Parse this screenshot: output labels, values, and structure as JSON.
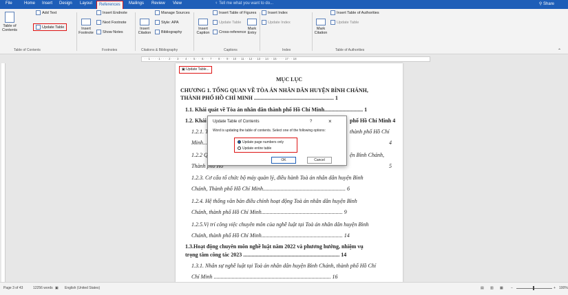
{
  "tabs": [
    "File",
    "Home",
    "Insert",
    "Design",
    "Layout",
    "References",
    "Mailings",
    "Review",
    "View"
  ],
  "tell_me": "Tell me what you want to do...",
  "share": "Share",
  "ribbon": {
    "toc": {
      "table_of_contents": "Table of Contents",
      "add_text": "Add Text",
      "update_table": "Update Table",
      "label": "Table of Contents"
    },
    "footnotes": {
      "insert_footnote": "Insert Footnote",
      "insert_endnote": "Insert Endnote",
      "next_footnote": "Next Footnote",
      "show_notes": "Show Notes",
      "label": "Footnotes"
    },
    "citations": {
      "insert_citation": "Insert Citation",
      "manage_sources": "Manage Sources",
      "style": "Style: APA",
      "bibliography": "Bibliography",
      "label": "Citations & Bibliography"
    },
    "captions": {
      "insert_caption": "Insert Caption",
      "insert_table_of_figures": "Insert Table of Figures",
      "update_table": "Update Table",
      "cross_reference": "Cross-reference",
      "label": "Captions"
    },
    "index": {
      "mark_entry": "Mark Entry",
      "insert_index": "Insert Index",
      "update_index": "Update Index",
      "label": "Index"
    },
    "authorities": {
      "mark_citation": "Mark Citation",
      "insert_table_of_authorities": "Insert Table of Authorities",
      "update_table": "Update Table",
      "label": "Table of Authorities"
    }
  },
  "document": {
    "toc_update_button": "Update Table...",
    "title": "MỤC LỤC",
    "lines": [
      {
        "text": "CHƯƠNG 1. TỔNG QUAN VỀ TÒA ÁN NHÂN DÂN HUYỆN BÌNH CHÁNH,",
        "style": "b"
      },
      {
        "text": "THÀNH PHỐ HỒ CHÍ MINH .......................................................... 1",
        "style": "b"
      },
      {
        "text": "1.1. Khái quát về Tòa án nhân dân thành phố Hồ Chí Minh............................ 1",
        "style": "b"
      },
      {
        "text": "1.2. Khái quát v",
        "style": "b"
      },
      {
        "text": "1.2.1. Thông ti",
        "style": "i"
      },
      {
        "text": "Minh..............",
        "style": "i"
      },
      {
        "text": "1.2.2 Quá trình",
        "style": "i"
      },
      {
        "text": "Thành phố Hồ",
        "style": "i"
      },
      {
        "text": "1.2.3. Cơ cấu tổ chức bộ máy quản lý, điều hành Toà án nhân dân huyện Bình",
        "style": "i"
      },
      {
        "text": "Chánh, Thành phố Hồ Chí Minh............................................................ 6",
        "style": "i"
      },
      {
        "text": "1.2.4. Hệ thống văn bản điều chỉnh hoạt động Toà án nhân dân huyện Bình",
        "style": "i"
      },
      {
        "text": "Chánh, thành phố Hồ Chí Minh........................................................... 9",
        "style": "i"
      },
      {
        "text": "1.2.5.Vị trí công việc chuyên môn của nghề luật tại Toà án nhân dân huyện Bình",
        "style": "i"
      },
      {
        "text": "Chánh, thành phố Hồ Chí Minh........................................................... 14",
        "style": "i"
      },
      {
        "text": "1.3.Hoạt động chuyên môn nghề luật năm 2022 và phương hướng, nhiệm vụ",
        "style": "b"
      },
      {
        "text": "trọng tâm công tác 2023 ...................................................................... 14",
        "style": "b"
      },
      {
        "text": "1.3.1. Nhân sự nghề luật tại Toà án nhân dân huyện Bình Chánh, thành phố Hồ Chí",
        "style": "i"
      },
      {
        "text": "Chí Minh ..................................................................................... 16",
        "style": "i"
      }
    ],
    "right_fragments": [
      "phố Hồ Chí Minh 4",
      "thành phố Hồ Chí",
      "4",
      "ện Bình Chánh,",
      "5"
    ]
  },
  "dialog": {
    "title": "Update Table of Contents",
    "help": "?",
    "close": "×",
    "message": "Word is updating the table of contents. Select one of the following options:",
    "option_page_numbers": "Update page numbers only",
    "option_entire_table": "Update entire table",
    "selected": "page_numbers",
    "ok": "OK",
    "cancel": "Cancel"
  },
  "status": {
    "page": "Page 3 of 43",
    "words": "12256 words",
    "language": "English (United States)",
    "zoom": "100%"
  },
  "colors": {
    "accent": "#1e5eb8",
    "highlight": "#dd1111"
  }
}
